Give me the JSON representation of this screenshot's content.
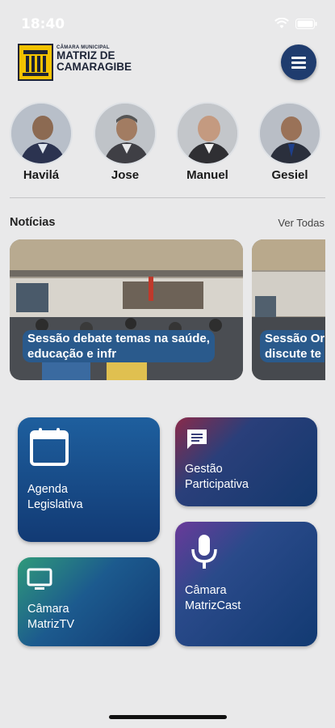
{
  "status_bar": {
    "time": "18:40"
  },
  "header": {
    "logo_small": "CÂMARA MUNICIPAL",
    "logo_line1": "MATRIZ DE",
    "logo_line2": "CAMARAGIBE"
  },
  "members": [
    {
      "name": "Havilá"
    },
    {
      "name": "Jose"
    },
    {
      "name": "Manuel"
    },
    {
      "name": "Gesiel"
    }
  ],
  "news": {
    "section_title": "Notícias",
    "see_all": "Ver Todas",
    "items": [
      {
        "caption_line1": "Sessão debate temas na saúde,",
        "caption_line2": "educação e infr"
      },
      {
        "caption_line1": "Sessão Or",
        "caption_line2": "discute te"
      }
    ]
  },
  "tiles": {
    "agenda": {
      "line1": "Agenda",
      "line2": "Legislativa"
    },
    "gestao": {
      "line1": "Gestão",
      "line2": "Participativa"
    },
    "tv": {
      "line1": "Câmara",
      "line2": "MatrizTV"
    },
    "cast": {
      "line1": "Câmara",
      "line2": "MatrizCast"
    }
  },
  "icons": [
    "wifi-icon",
    "battery-icon",
    "menu-icon",
    "calendar-icon",
    "chat-icon",
    "tv-icon",
    "microphone-icon"
  ],
  "colors": {
    "primary": "#1f3c6e",
    "accent_yellow": "#f2c200",
    "background": "#e9e9ea"
  }
}
